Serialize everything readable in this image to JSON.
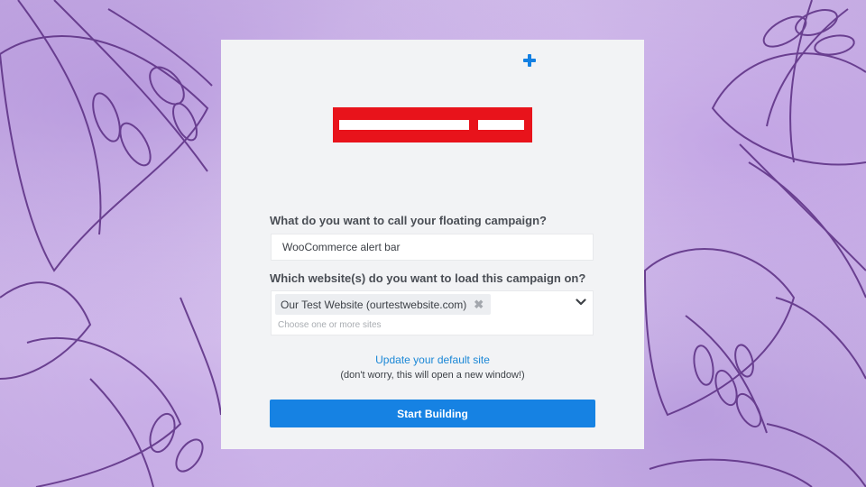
{
  "campaign_name": {
    "label": "What do you want to call your floating campaign?",
    "value": "WooCommerce alert bar"
  },
  "website_select": {
    "label": "Which website(s) do you want to load this campaign on?",
    "selected_tag": "Our Test Website (ourtestwebsite.com)",
    "remove_glyph": "✖",
    "placeholder": "Choose one or more sites"
  },
  "update_site_link": "Update your default site",
  "note": "(don't worry, this will open a new window!)",
  "start_button_label": "Start Building",
  "colors": {
    "accent": "#1682e3",
    "link": "#1a87d6",
    "logo_red": "#e8131b",
    "card_bg": "#f2f3f5",
    "background_lavender": "#d9c7ee"
  },
  "icons": {
    "plus": "plus-icon",
    "chevron": "chevron-down-icon",
    "tag_remove": "close-icon"
  }
}
